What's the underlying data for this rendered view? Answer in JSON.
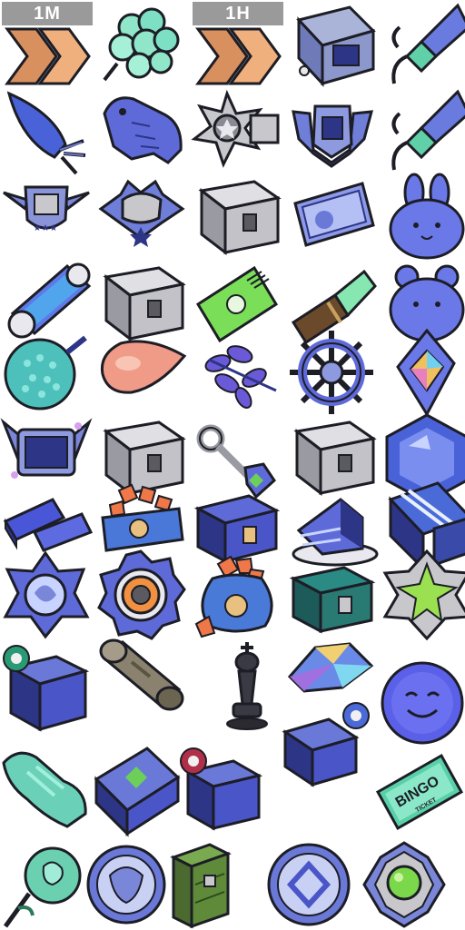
{
  "speedup_badges": {
    "one_minute": "1M",
    "one_hour": "1H"
  },
  "tickets": {
    "bingo_title": "BINGO",
    "bingo_sub": "TICKET"
  },
  "icons": [
    [
      "chevron-speedup-icon",
      "rose-bouquet-icon",
      "chevron-speedup-icon",
      "treasure-machine-icon",
      "firework-rocket-icon"
    ],
    [
      "carrot-icon",
      "tiger-statue-icon",
      "star-emblem-icon",
      "winged-shield-icon",
      "firework-rocket-icon"
    ],
    [
      "winged-crest-icon",
      "helmet-crest-icon",
      "silver-chest-icon",
      "ticket-icon",
      "bunny-plush-icon"
    ],
    [
      "energy-capsule-icon",
      "silver-chest-icon",
      "green-barcode-ticket-icon",
      "lipstick-icon",
      "jelly-bear-icon"
    ],
    [
      "spiky-ball-icon",
      "teardrop-icon",
      "orchid-flower-icon",
      "ship-wheel-icon",
      "rainbow-gem-badge-icon"
    ],
    [
      "winged-frame-icon",
      "silver-chest-icon",
      "key-icon",
      "silver-chest-icon",
      "sapphire-gem-icon"
    ],
    [
      "blue-bricks-icon",
      "gem-crate-icon",
      "blue-chest-icon",
      "cake-slice-icon",
      "wrapped-gift-icon"
    ],
    [
      "ornate-medal-icon",
      "gear-ring-icon",
      "coin-sack-icon",
      "teal-chest-icon",
      "green-star-gem-icon"
    ],
    [
      "mystery-cube-icon",
      "metal-barrel-icon",
      "",
      "chess-king-icon",
      "crystal-shard-icon",
      "smile-coin-icon",
      "rune-cube-icon"
    ],
    [
      "green-claw-icon",
      "mystery-cube-icon",
      "rune-cube-icon",
      "bingo-ticket-icon"
    ],
    [
      "green-rose-icon",
      "lion-medallion-icon",
      "green-crate-icon",
      "diamond-coin-icon",
      "green-orb-crown-icon"
    ]
  ],
  "colors": {
    "blue": "#5b6ad8",
    "blue_dark": "#2d3586",
    "blue_light": "#aab4f4",
    "silver": "#c8c8cc",
    "silver_dark": "#5a5a60",
    "mint": "#7de0c4",
    "orange": "#e88a4a",
    "peach": "#f09a88",
    "green": "#6ccf5a",
    "outline": "#1d1d26"
  }
}
